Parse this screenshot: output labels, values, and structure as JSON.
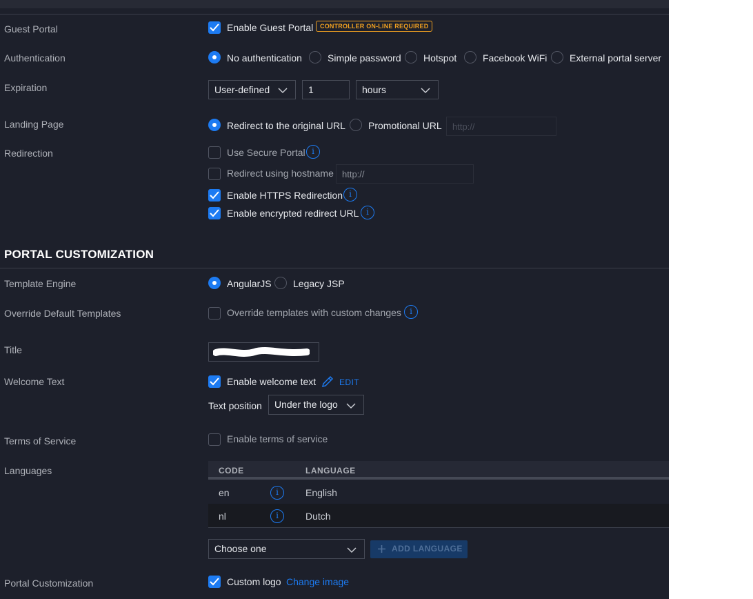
{
  "guest_portal": {
    "label": "Guest Portal",
    "enable_label": "Enable Guest Portal",
    "enabled": true,
    "badge": "CONTROLLER ON-LINE REQUIRED"
  },
  "authentication": {
    "label": "Authentication",
    "options": [
      "No authentication",
      "Simple password",
      "Hotspot",
      "Facebook WiFi",
      "External portal server"
    ],
    "selected": "No authentication"
  },
  "expiration": {
    "label": "Expiration",
    "mode": "User-defined",
    "value": "1",
    "unit": "hours"
  },
  "landing_page": {
    "label": "Landing Page",
    "options": [
      "Redirect to the original URL",
      "Promotional URL"
    ],
    "selected": "Redirect to the original URL",
    "promo_placeholder": "http://"
  },
  "redirection": {
    "label": "Redirection",
    "secure_portal": "Use Secure Portal",
    "hostname": "Redirect using hostname",
    "hostname_placeholder": "http://",
    "https": "Enable HTTPS Redirection",
    "encrypted": "Enable encrypted redirect URL"
  },
  "customization": {
    "section_title": "PORTAL CUSTOMIZATION",
    "template_engine": {
      "label": "Template Engine",
      "options": [
        "AngularJS",
        "Legacy JSP"
      ],
      "selected": "AngularJS"
    },
    "override": {
      "label": "Override Default Templates",
      "option": "Override templates with custom changes"
    },
    "title": {
      "label": "Title"
    },
    "welcome": {
      "label": "Welcome Text",
      "enable": "Enable welcome text",
      "edit": "EDIT",
      "position_label": "Text position",
      "position_value": "Under the logo"
    },
    "tos": {
      "label": "Terms of Service",
      "enable": "Enable terms of service"
    },
    "languages": {
      "label": "Languages",
      "col_code": "CODE",
      "col_language": "LANGUAGE",
      "rows": [
        {
          "code": "en",
          "language": "English"
        },
        {
          "code": "nl",
          "language": "Dutch"
        }
      ],
      "choose": "Choose one",
      "add_button": "ADD LANGUAGE"
    },
    "portal": {
      "label": "Portal Customization",
      "custom_logo": "Custom logo",
      "change_image": "Change image"
    }
  },
  "colors": {
    "background": "#1d202b",
    "accent": "#1d7bf2",
    "warning": "#f0a020"
  }
}
